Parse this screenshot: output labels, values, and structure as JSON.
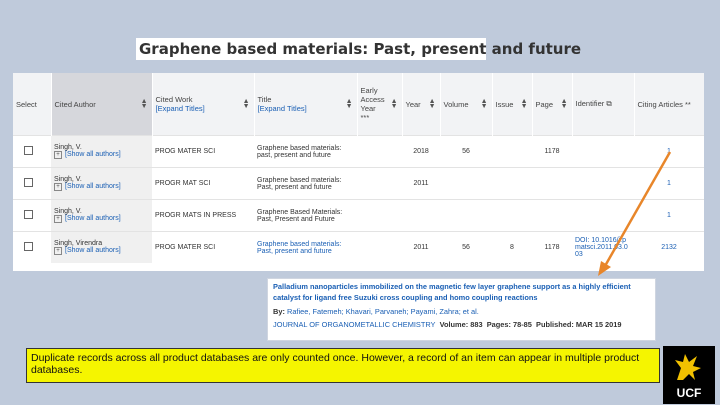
{
  "title": "Graphene based materials: Past, present and future",
  "columns": [
    {
      "label": "Select",
      "sub": ""
    },
    {
      "label": "Cited Author",
      "sub": ""
    },
    {
      "label": "Cited Work",
      "sub": "[Expand Titles]"
    },
    {
      "label": "Title",
      "sub": "[Expand Titles]"
    },
    {
      "label": "Early Access Year",
      "sub": "***"
    },
    {
      "label": "Year",
      "sub": ""
    },
    {
      "label": "Volume",
      "sub": ""
    },
    {
      "label": "Issue",
      "sub": ""
    },
    {
      "label": "Page",
      "sub": ""
    },
    {
      "label": "Identifier",
      "sub": ""
    },
    {
      "label": "Citing Articles **",
      "sub": ""
    }
  ],
  "rows": [
    {
      "author": "Singh, V.",
      "show_all": "[Show all authors]",
      "cited_work": "PROG MATER SCI",
      "title": "Graphene based materials: past, present and future",
      "early": "",
      "year": "2018",
      "volume": "56",
      "issue": "",
      "page": "1178",
      "identifier": "",
      "citing": "1"
    },
    {
      "author": "Singh, V.",
      "show_all": "[Show all authors]",
      "cited_work": "PROGR MAT SCI",
      "title": "Graphene based materials: Past, present and future",
      "early": "",
      "year": "2011",
      "volume": "",
      "issue": "",
      "page": "",
      "identifier": "",
      "citing": "1"
    },
    {
      "author": "Singh, V.",
      "show_all": "[Show all authors]",
      "cited_work": "PROGR MATS IN PRESS",
      "title": "Graphene Based Materials: Past, Present and Future",
      "early": "",
      "year": "",
      "volume": "",
      "issue": "",
      "page": "",
      "identifier": "",
      "citing": "1"
    },
    {
      "author": "Singh, Virendra",
      "show_all": "[Show all authors]",
      "cited_work": "PROG MATER SCI",
      "title": "Graphene based materials: Past, present and future",
      "early": "",
      "year": "2011",
      "volume": "56",
      "issue": "8",
      "page": "1178",
      "identifier": "DOI: 10.1016/j.pmatsci.2011.03.003",
      "citing": "2132"
    }
  ],
  "popup": {
    "title": "Palladium nanoparticles immobilized on the magnetic few layer graphene support as a highly efficient catalyst for ligand free Suzuki cross coupling and homo coupling reactions",
    "by_label": "By:",
    "authors": "Rafiee, Fatemeh; Khavari, Parvaneh; Payami, Zahra; et al.",
    "journal": "JOURNAL OF ORGANOMETALLIC CHEMISTRY",
    "volume_label": "Volume: 883",
    "pages_label": "Pages: 78-85",
    "published_label": "Published: MAR 15 2019"
  },
  "note": "Duplicate records across all product databases are only counted once. However, a record of an item can appear in multiple product databases.",
  "logo_text": "UCF",
  "colors": {
    "background": "#bfcadb",
    "link": "#1a5fb4",
    "note_bg": "#f5f500",
    "arrow": "#e8862a"
  }
}
